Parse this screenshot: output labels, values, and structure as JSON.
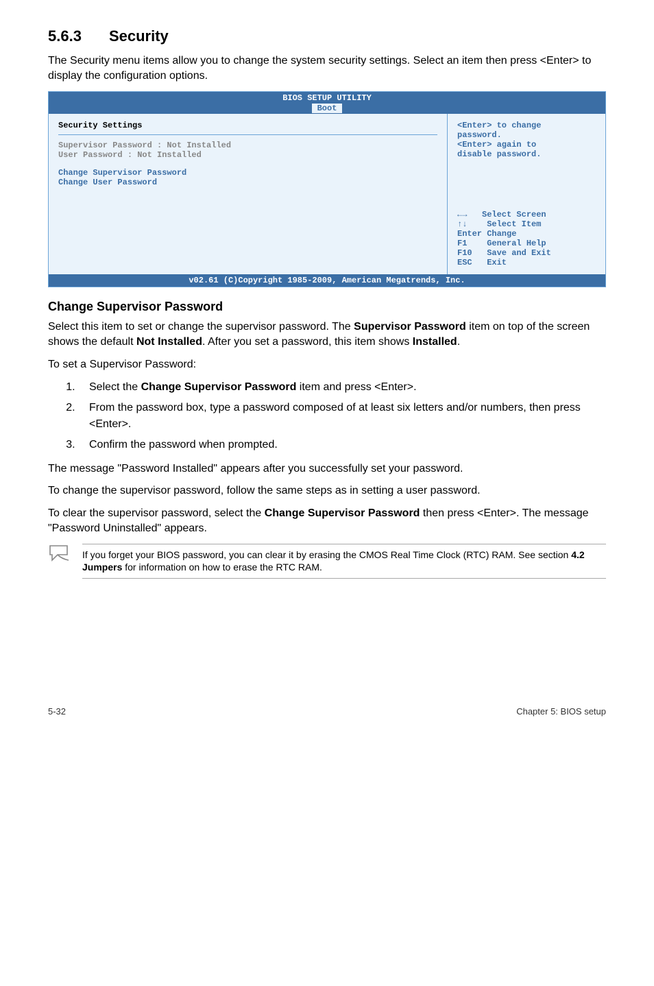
{
  "section": {
    "number": "5.6.3",
    "title": "Security"
  },
  "intro": "The Security menu items allow you to change the system security settings. Select an item then press <Enter> to display the configuration options.",
  "bios": {
    "title": "BIOS SETUP UTILITY",
    "tab": "Boot",
    "left": {
      "heading": "Security Settings",
      "line1": "Supervisor Password : Not Installed",
      "line2": "User Password       : Not Installed",
      "option1": "Change Supervisor Password",
      "option2": "Change User Password"
    },
    "right": {
      "help1": "<Enter> to change",
      "help2": "password.",
      "help3": "<Enter> again to",
      "help4": "disable password.",
      "nav1": "←→   Select Screen",
      "nav2": "↑↓    Select Item",
      "nav3": "Enter Change",
      "nav4": "F1    General Help",
      "nav5": "F10   Save and Exit",
      "nav6": "ESC   Exit"
    },
    "footer": "v02.61 (C)Copyright 1985-2009, American Megatrends, Inc."
  },
  "subhead": "Change Supervisor Password",
  "para1_a": "Select this item to set or change the supervisor password. The ",
  "para1_b": "Supervisor Password",
  "para1_c": " item on top of the screen shows the default ",
  "para1_d": "Not Installed",
  "para1_e": ". After you set a password, this item shows ",
  "para1_f": "Installed",
  "para1_g": ".",
  "para2": "To set a Supervisor Password:",
  "list": {
    "item1_a": "Select the ",
    "item1_b": "Change Supervisor Password",
    "item1_c": " item and press <Enter>.",
    "item2": "From the password box, type a password composed of at least six letters and/or numbers, then press <Enter>.",
    "item3": "Confirm the password when prompted."
  },
  "para3": "The message \"Password Installed\" appears after you successfully set your password.",
  "para4": "To change the supervisor password, follow the same steps as in setting a user password.",
  "para5_a": "To clear the supervisor password, select the ",
  "para5_b": "Change Supervisor Password",
  "para5_c": " then press <Enter>. The message \"Password Uninstalled\" appears.",
  "note_a": "If you forget your BIOS password, you can clear it by erasing the CMOS Real Time Clock (RTC) RAM. See section ",
  "note_b": "4.2 Jumpers",
  "note_c": " for information on how to erase the RTC RAM.",
  "footer": {
    "left": "5-32",
    "right": "Chapter 5: BIOS setup"
  }
}
